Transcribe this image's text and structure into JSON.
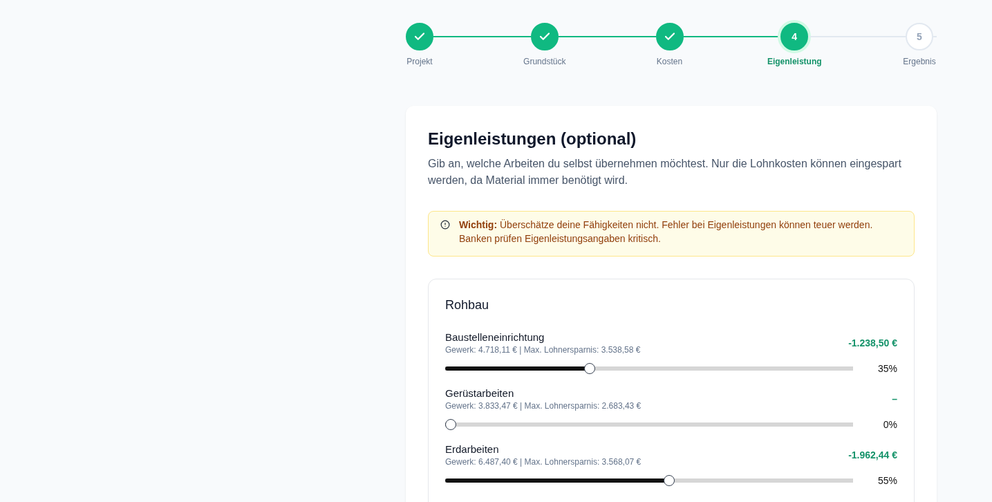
{
  "stepper": [
    {
      "label": "Projekt",
      "completed": true,
      "selected": false
    },
    {
      "label": "Grundstück",
      "completed": true,
      "selected": false
    },
    {
      "label": "Kosten",
      "completed": true,
      "selected": false
    },
    {
      "label": "Eigenleistung",
      "number": "4",
      "completed": false,
      "selected": true
    },
    {
      "label": "Ergebnis",
      "number": "5",
      "completed": false,
      "selected": false
    }
  ],
  "card": {
    "title": "Eigenleistungen (optional)",
    "description": "Gib an, welche Arbeiten du selbst übernehmen möchtest. Nur die Lohnkosten können eingespart werden, da Material immer benötigt wird.",
    "warning": {
      "text": "**Wichtig:** Überschätze deine Fähigkeiten nicht. Fehler bei Eigenleistungen können teuer werden. Banken prüfen Eigenleistungsangaben kritisch."
    },
    "section": {
      "title": "Rohbau",
      "items": [
        {
          "name": "Baustelleneinrichtung",
          "details": "Gewerk: 4.718,11 € | Max. Lohnersparnis: 3.538,58 €",
          "saving": "-1.238,50 €",
          "level": 0.35,
          "percent": "35%"
        },
        {
          "name": "Gerüstarbeiten",
          "details": "Gewerk: 3.833,47 € | Max. Lohnersparnis: 2.683,43 €",
          "saving": "–",
          "level": 0,
          "percent": "0%"
        },
        {
          "name": "Erdarbeiten",
          "details": "Gewerk: 6.487,40 € | Max. Lohnersparnis: 3.568,07 €",
          "saving": "-1.962,44 €",
          "level": 0.55,
          "percent": "55%"
        }
      ]
    }
  }
}
